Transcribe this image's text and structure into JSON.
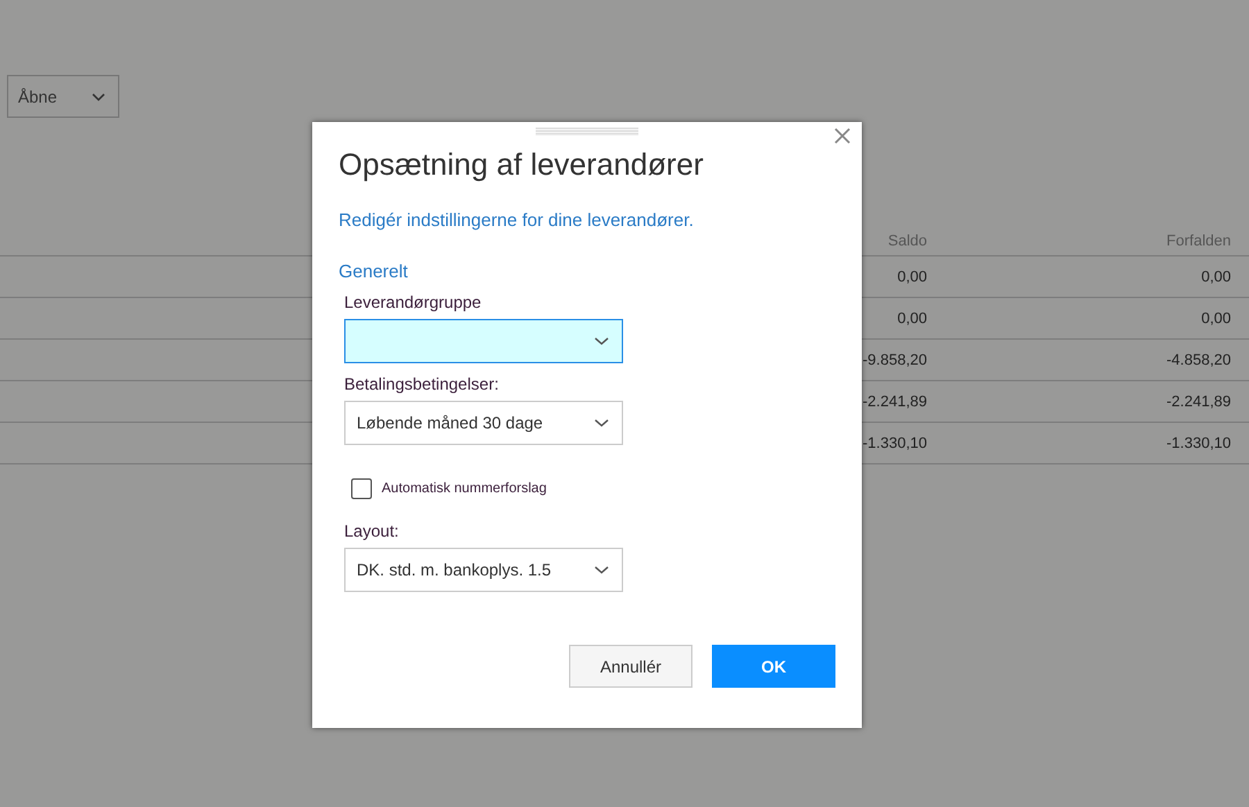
{
  "filter_dropdown": {
    "value": "Åbne"
  },
  "table": {
    "columns": [
      "Saldo",
      "Forfalden"
    ],
    "rows": [
      [
        "0,00",
        "0,00"
      ],
      [
        "0,00",
        "0,00"
      ],
      [
        "-9.858,20",
        "-4.858,20"
      ],
      [
        "-2.241,89",
        "-2.241,89"
      ],
      [
        "-1.330,10",
        "-1.330,10"
      ]
    ]
  },
  "dialog": {
    "title": "Opsætning af leverandører",
    "subtitle": "Redigér indstillingerne for dine leverandører.",
    "section": "Generelt",
    "fields": [
      {
        "kind": "select",
        "label": "Leverandørgruppe",
        "focused": true
      },
      {
        "kind": "select",
        "label": "Betalingsbetingelser:",
        "value": "Løbende måned 30 dage",
        "focused": false
      },
      {
        "kind": "checkbox",
        "label": "Automatisk nummerforslag",
        "checked": false
      },
      {
        "kind": "select",
        "label": "Layout:",
        "value": "DK. std. m. bankoplys. 1.5",
        "focused": false
      }
    ],
    "buttons": [
      {
        "label": "Annullér",
        "primary": false
      },
      {
        "label": "OK",
        "primary": true
      }
    ]
  }
}
